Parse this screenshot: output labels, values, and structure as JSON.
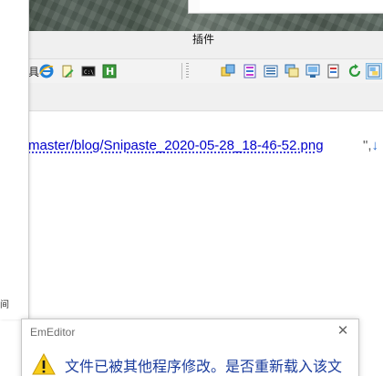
{
  "toolbar": {
    "plugins_label": "插件",
    "icons": [
      "ie-browser-icon",
      "edit-document-icon",
      "command-prompt-icon",
      "html-icon",
      "plugin-icon-1",
      "plugin-icon-2",
      "plugin-icon-3",
      "plugin-icon-4",
      "plugin-icon-5",
      "plugin-icon-6",
      "plugin-icon-7",
      "plugin-icon-8"
    ],
    "active_icon": "plugin-icon-8"
  },
  "editor": {
    "line_text": "master/blog/Snipaste_2020-05-28_18-46-52.png",
    "line_suffix": "\",",
    "line_end_marker": "↓"
  },
  "left_panel": {
    "bottom_text": "间"
  },
  "dialog": {
    "title": "EmEditor",
    "close_glyph": "✕",
    "message": "文件已被其他程序修改。是否重新载入该文"
  },
  "colors": {
    "link_blue": "#0000cc",
    "dialog_text_blue": "#1a3c9c",
    "warning_yellow": "#f8cd1a",
    "active_button": "#cde6f7"
  }
}
